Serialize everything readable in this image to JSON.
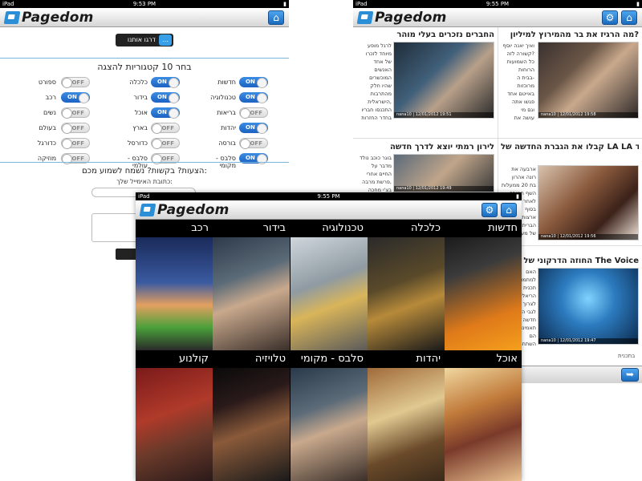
{
  "screenA": {
    "status": {
      "carrier": "iPad",
      "time": "9:53 PM"
    },
    "app_name": "Pagedom",
    "home_icon": "home-icon",
    "contact_button": "דרגו אותנו",
    "categories_title": "בחר 10 קטגוריות להצגה",
    "toggles": [
      {
        "label": "חדשות",
        "state": "ON"
      },
      {
        "label": "כלכלה",
        "state": "ON"
      },
      {
        "label": "ספורט",
        "state": "OFF"
      },
      {
        "label": "טכנולוגיה",
        "state": "ON"
      },
      {
        "label": "בידור",
        "state": "ON"
      },
      {
        "label": "רכב",
        "state": "ON"
      },
      {
        "label": "בריאות",
        "state": "OFF"
      },
      {
        "label": "אוכל",
        "state": "ON"
      },
      {
        "label": "נשים",
        "state": "OFF"
      },
      {
        "label": "יהדות",
        "state": "ON"
      },
      {
        "label": "בארץ",
        "state": "OFF"
      },
      {
        "label": "בעולם",
        "state": "OFF"
      },
      {
        "label": "בורסה",
        "state": "OFF"
      },
      {
        "label": "כדורסל",
        "state": "OFF"
      },
      {
        "label": "כדורגל",
        "state": "OFF"
      },
      {
        "label": "סלבס - מקומי",
        "state": "ON"
      },
      {
        "label": "סלבס - עולמי",
        "state": "OFF"
      },
      {
        "label": "מוזיקה",
        "state": "OFF"
      }
    ],
    "suggestions_title": "הצעות? בקשות? נשמח לשמוע מכם:",
    "email_label": "כתובת האימייל שלך:"
  },
  "screenB": {
    "status": {
      "carrier": "iPad",
      "time": "9:55 PM"
    },
    "app_name": "Pagedom",
    "articles": [
      {
        "title": "מה הרגיז את בר מהמירוץ למיליון?",
        "text": "ואיך יאנה יוסף\nקשורה לזה?\nכל השמועות\nהרוחות\nבבית ה-\nמרוכזות\nבאייטם אחד\nפגשו אתה\nוגם מי\nעושה את",
        "caption": "nana10 | 12/01/2012 19:58"
      },
      {
        "title": "החברים נזכרים בעלי מוהר",
        "text": "לרגל מופע\nמיוחד לזכרו\nשל אחד\nהאנשים\nהמוכשרים\nשהיו חלק\nמהתרבות\nהישראלית,\nהתכנסו חבריו\nבחדר החזרות",
        "caption": "nana10 | 12/01/2012 19:51"
      },
      {
        "title": "קבלו את הגברת החדשה של LA LA לנד",
        "text": "ארבעה את\nרונה אהרון\nבת 20 ממעלות\nהשף המוכר\nלאחר ש\nבסוף\nארצות\nהברית\nשל מעוז",
        "caption": "nana10 | 12/01/2012 19:56"
      },
      {
        "title": "לירון רמתי יוצא לדרך חדשה",
        "text": "בוגר כוכב נולד\nמדבר על\nהחיים אחרי\nפרשת מרבה,\nבצ'י מחכה\n",
        "caption": "nana10 | 12/01/2012 19:49"
      },
      {
        "title": "החוזה הדרקוני של The Voice",
        "text": "האם\nלמתמודדים\nתכנית\nהריאליטי\nלצרוך\nלגבי ה\nחדשה\nתאמינו\nהם\nהשתתפו",
        "caption": "nana10 | 12/01/2012 19:47"
      }
    ],
    "more_label": "בתכנית",
    "back_icon": "back-icon"
  },
  "screenC": {
    "status": {
      "carrier": "iPad",
      "time": "9:55 PM"
    },
    "app_name": "Pagedom",
    "tiles": [
      {
        "label": "חדשות"
      },
      {
        "label": "כלכלה"
      },
      {
        "label": "טכנולוגיה"
      },
      {
        "label": "בידור"
      },
      {
        "label": "רכב"
      },
      {
        "label": "אוכל"
      },
      {
        "label": "יהדות"
      },
      {
        "label": "סלבס - מקומי"
      },
      {
        "label": "טלויזיה"
      },
      {
        "label": "קולנוע"
      }
    ]
  }
}
